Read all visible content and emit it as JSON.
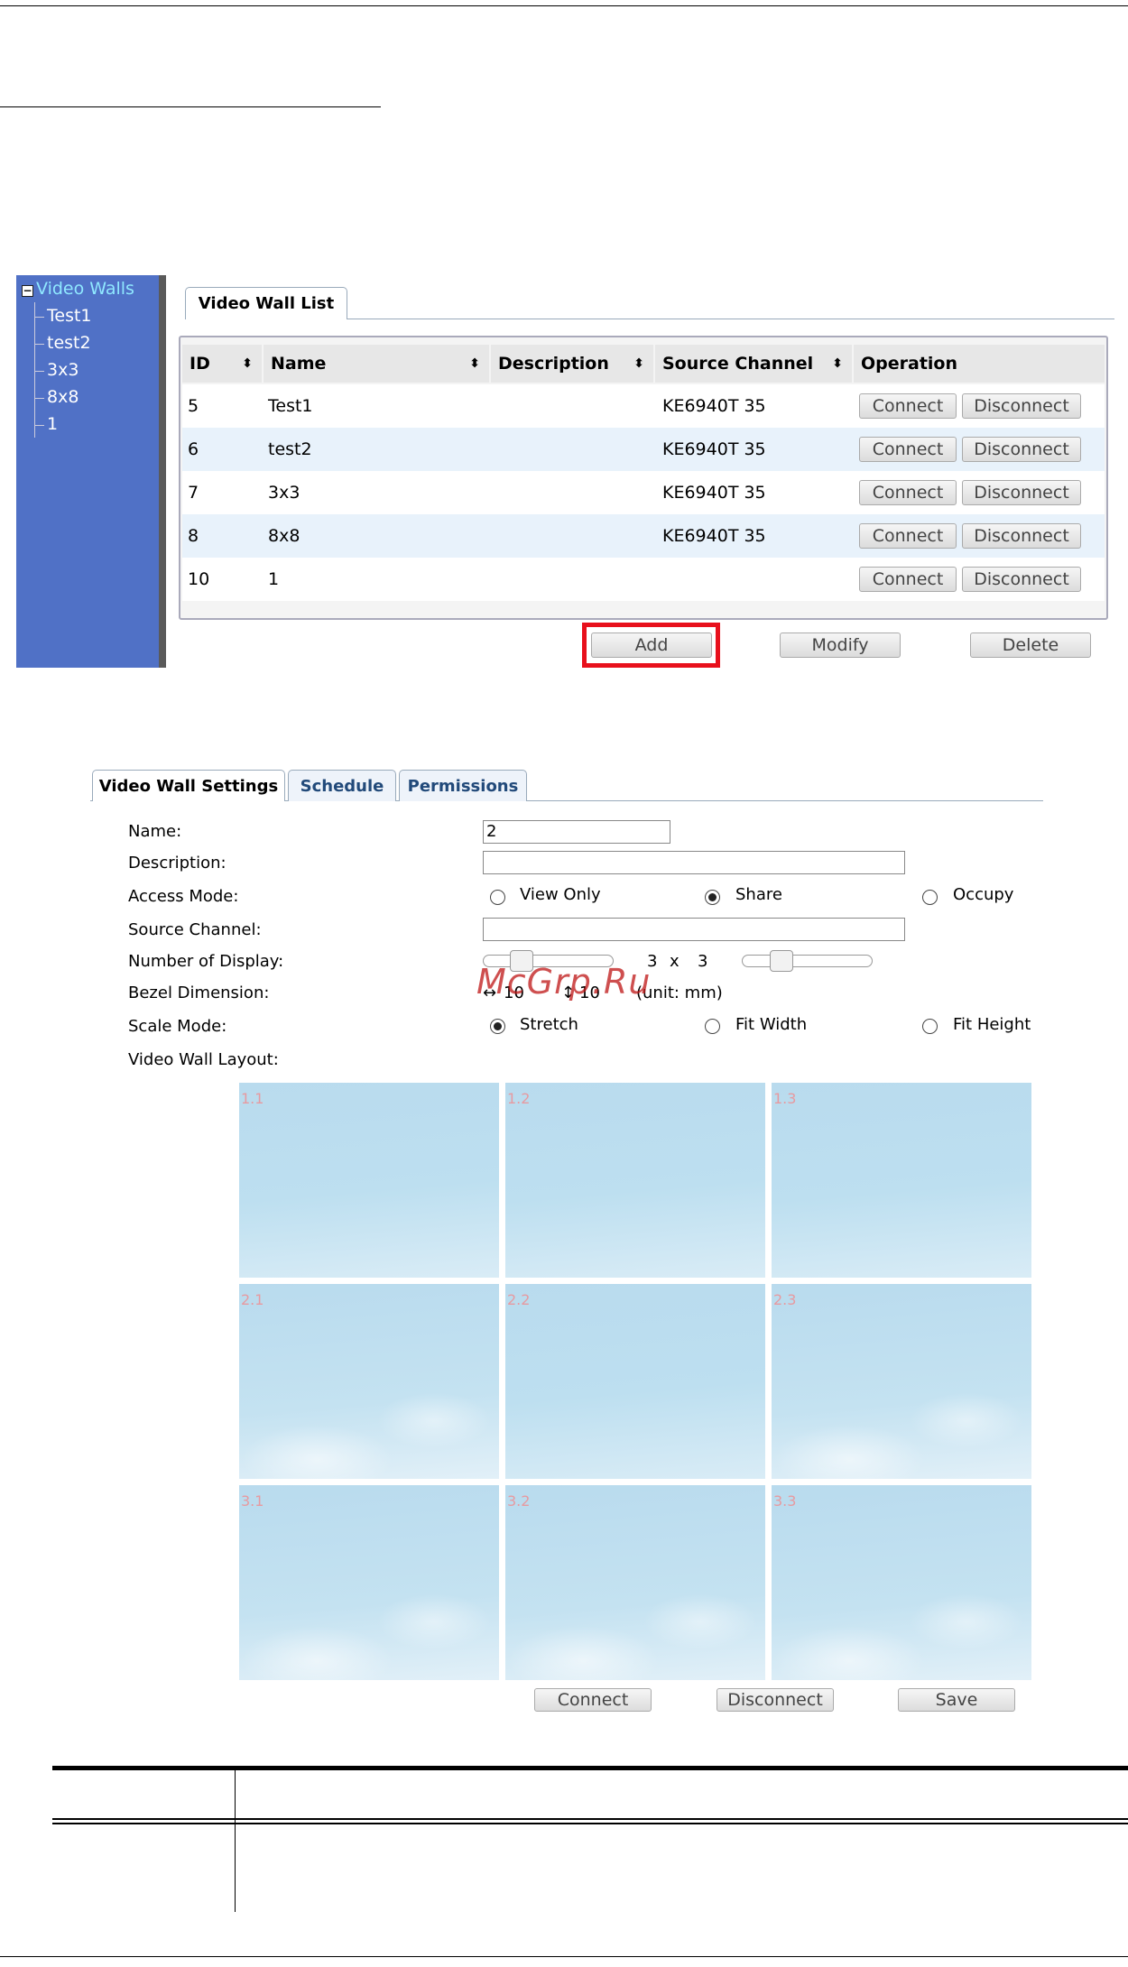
{
  "tree": {
    "root": "Video Walls",
    "items": [
      "Test1",
      "test2",
      "3x3",
      "8x8",
      "1"
    ]
  },
  "list": {
    "tab": "Video Wall List",
    "headers": [
      "ID",
      "Name",
      "Description",
      "Source Channel",
      "Operation"
    ],
    "rows": [
      {
        "id": "5",
        "name": "Test1",
        "description": "",
        "source": "KE6940T 35"
      },
      {
        "id": "6",
        "name": "test2",
        "description": "",
        "source": "KE6940T 35"
      },
      {
        "id": "7",
        "name": "3x3",
        "description": "",
        "source": "KE6940T 35"
      },
      {
        "id": "8",
        "name": "8x8",
        "description": "",
        "source": "KE6940T 35"
      },
      {
        "id": "10",
        "name": "1",
        "description": "",
        "source": ""
      }
    ],
    "connect_label": "Connect",
    "disconnect_label": "Disconnect",
    "add_label": "Add",
    "modify_label": "Modify",
    "delete_label": "Delete"
  },
  "settings": {
    "tabs": [
      "Video Wall Settings",
      "Schedule",
      "Permissions"
    ],
    "labels": {
      "name": "Name:",
      "description": "Description:",
      "access_mode": "Access Mode:",
      "source_channel": "Source Channel:",
      "number_of_display": "Number of Display:",
      "bezel_dimension": "Bezel Dimension:",
      "scale_mode": "Scale Mode:",
      "layout": "Video Wall Layout:"
    },
    "name_value": "2",
    "description_value": "",
    "source_channel_value": "",
    "access_options": [
      "View Only",
      "Share",
      "Occupy"
    ],
    "access_selected": "Share",
    "display_cols": "3",
    "display_x": "x",
    "display_rows": "3",
    "bezel_h": "10",
    "bezel_v": "10",
    "bezel_unit": "(unit: mm)",
    "scale_options": [
      "Stretch",
      "Fit Width",
      "Fit Height"
    ],
    "scale_selected": "Stretch",
    "cells": [
      "1.1",
      "1.2",
      "1.3",
      "2.1",
      "2.2",
      "2.3",
      "3.1",
      "3.2",
      "3.3"
    ],
    "connect_label": "Connect",
    "disconnect_label": "Disconnect",
    "save_label": "Save"
  },
  "watermark": "McGrp.Ru"
}
